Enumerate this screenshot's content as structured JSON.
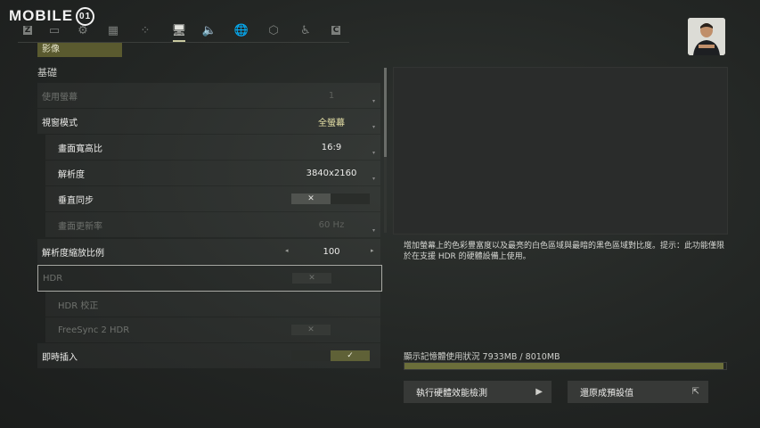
{
  "brand": {
    "name": "MOBILE",
    "emblem": "01"
  },
  "nav": {
    "tabs": [
      {
        "icon": "z-key-icon",
        "glyph": "Z",
        "active": false
      },
      {
        "icon": "display-card-icon",
        "glyph": "▭",
        "active": false
      },
      {
        "icon": "gear-icon",
        "glyph": "⚙",
        "active": false
      },
      {
        "icon": "gamepad-icon",
        "glyph": "▦",
        "active": false
      },
      {
        "icon": "network-icon",
        "glyph": "⁘",
        "active": false
      },
      {
        "icon": "monitor-icon",
        "glyph": "🖥",
        "active": true
      },
      {
        "icon": "speaker-icon",
        "glyph": "🔈",
        "active": false
      },
      {
        "icon": "globe-icon",
        "glyph": "🌐",
        "active": false
      },
      {
        "icon": "hexagon-icon",
        "glyph": "⬡",
        "active": false
      },
      {
        "icon": "accessibility-icon",
        "glyph": "♿",
        "active": false
      },
      {
        "icon": "c-key-icon",
        "glyph": "C",
        "active": false
      }
    ]
  },
  "category": "影像",
  "section_title": "基礎",
  "settings": [
    {
      "label": "使用螢幕",
      "value": "1",
      "dim": true,
      "sub": false,
      "caret": true
    },
    {
      "label": "視窗模式",
      "value": "全螢幕",
      "accent": true,
      "sub": false,
      "caret": true
    },
    {
      "label": "畫面寬高比",
      "value": "16:9",
      "sub": true,
      "caret": true
    },
    {
      "label": "解析度",
      "value": "3840x2160",
      "sub": true,
      "caret": true
    },
    {
      "label": "垂直同步",
      "toggle": "off",
      "sub": true
    },
    {
      "label": "畫面更新率",
      "value": "60 Hz",
      "dim": true,
      "sub": true,
      "caret": true
    },
    {
      "label": "解析度縮放比例",
      "value": "100",
      "sub": false,
      "slider": true
    },
    {
      "label": "HDR",
      "toggle": "off-dim",
      "dim": true,
      "sub": false,
      "selected": true
    },
    {
      "label": "HDR 校正",
      "dim": true,
      "sub": true
    },
    {
      "label": "FreeSync 2 HDR",
      "toggle": "off-dim",
      "dim": true,
      "sub": true
    },
    {
      "label": "即時插入",
      "toggle": "on",
      "sub": false
    }
  ],
  "description": "增加螢幕上的色彩豐富度以及最亮的白色區域與最暗的黑色區域對比度。提示：此功能僅限於在支援 HDR 的硬體設備上使用。",
  "vram": {
    "label": "顯示記憶體使用狀況 7933MB / 8010MB",
    "used_mb": 7933,
    "total_mb": 8010
  },
  "buttons": {
    "benchmark": "執行硬體效能檢測",
    "reset": "還原成預設值"
  },
  "colors": {
    "accent": "#5f6137",
    "bar": "#6b6e3a"
  }
}
